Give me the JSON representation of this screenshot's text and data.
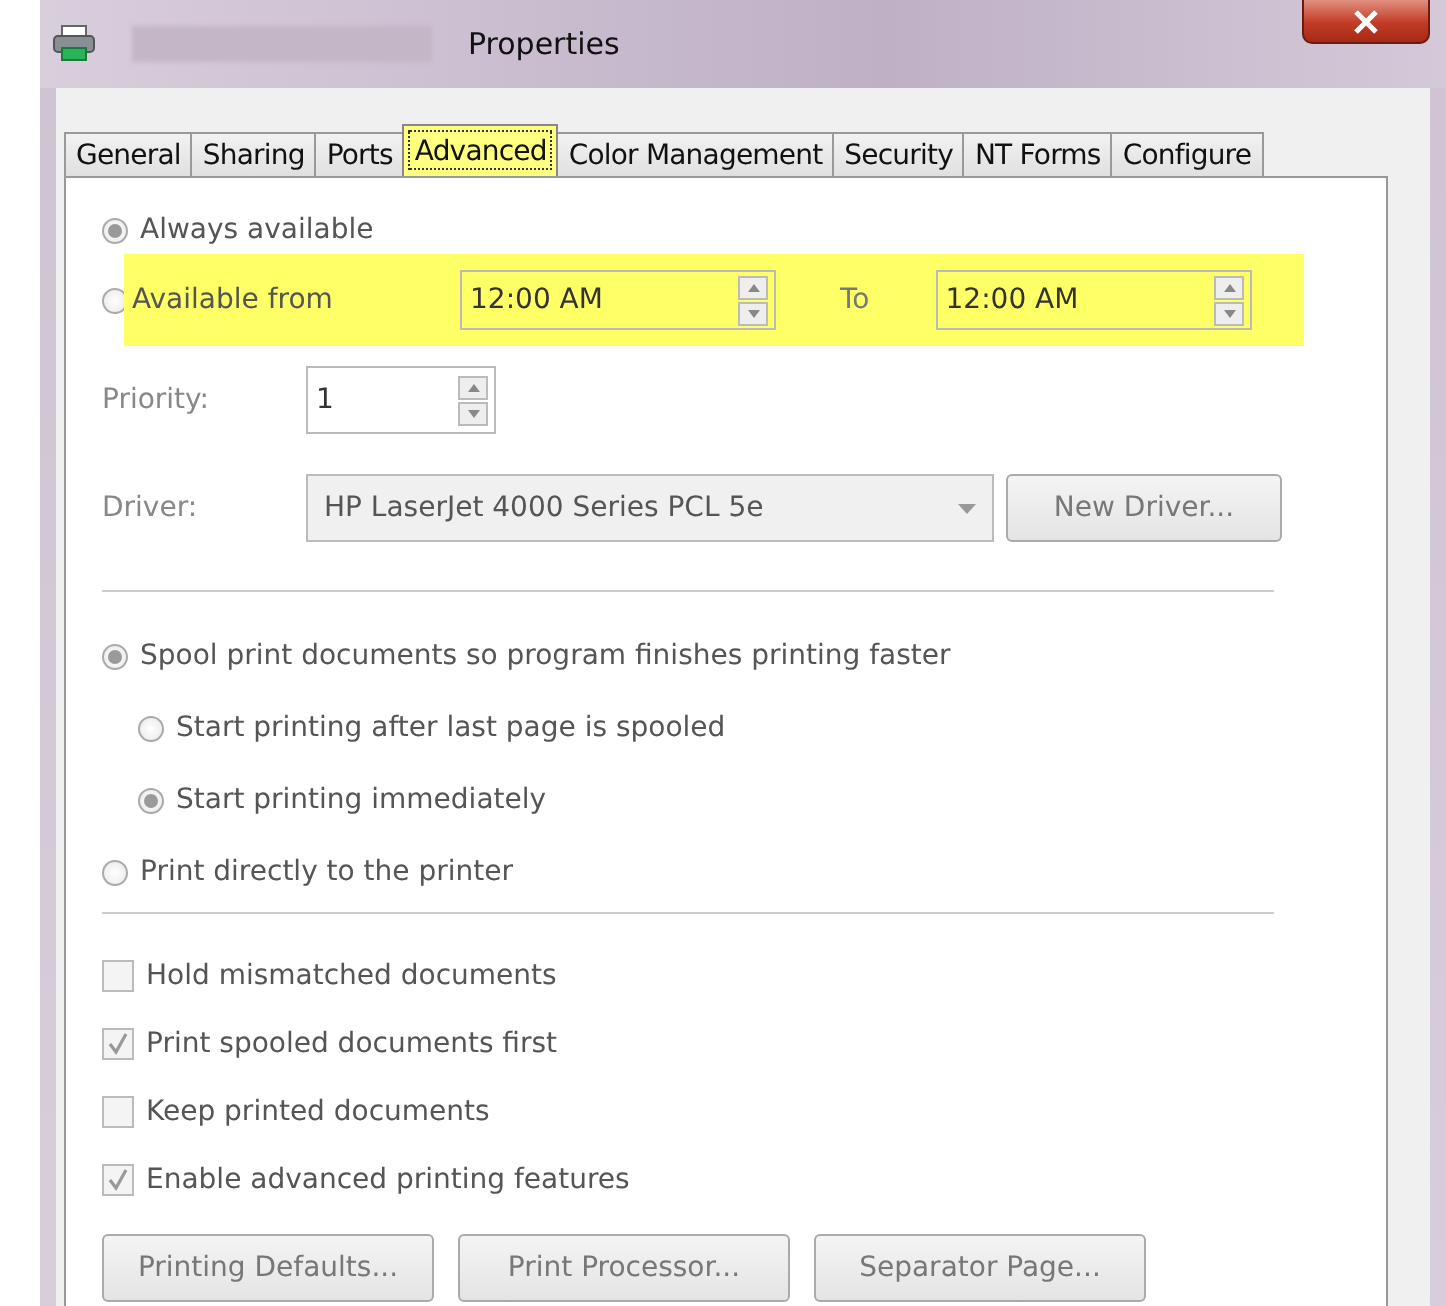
{
  "window": {
    "title": "Properties"
  },
  "disabled": true,
  "tabs": [
    {
      "label": "General",
      "selected": false
    },
    {
      "label": "Sharing",
      "selected": false
    },
    {
      "label": "Ports",
      "selected": false
    },
    {
      "label": "Advanced",
      "selected": true
    },
    {
      "label": "Color Management",
      "selected": false
    },
    {
      "label": "Security",
      "selected": false
    },
    {
      "label": "NT Forms",
      "selected": false
    },
    {
      "label": "Configure",
      "selected": false
    }
  ],
  "availability": {
    "options": [
      {
        "label": "Always available",
        "selected": true
      },
      {
        "label": "Available from",
        "selected": false
      }
    ],
    "from_time": "12:00 AM",
    "to_label": "To",
    "to_time": "12:00 AM",
    "highlighted": true
  },
  "priority": {
    "label": "Priority:",
    "value": "1"
  },
  "driver": {
    "label": "Driver:",
    "value": "HP LaserJet 4000 Series PCL 5e",
    "button": "New Driver..."
  },
  "spool_options": [
    {
      "label": "Spool print documents so program finishes printing faster",
      "selected": true,
      "children": [
        {
          "label": "Start printing after last page is spooled",
          "selected": false
        },
        {
          "label": "Start printing immediately",
          "selected": true
        }
      ]
    },
    {
      "label": "Print directly to the printer",
      "selected": false
    }
  ],
  "checkboxes": [
    {
      "label": "Hold mismatched documents",
      "checked": false
    },
    {
      "label": "Print spooled documents first",
      "checked": true
    },
    {
      "label": "Keep printed documents",
      "checked": false
    },
    {
      "label": "Enable advanced printing features",
      "checked": true
    }
  ],
  "buttons": [
    "Printing Defaults...",
    "Print Processor...",
    "Separator Page..."
  ]
}
